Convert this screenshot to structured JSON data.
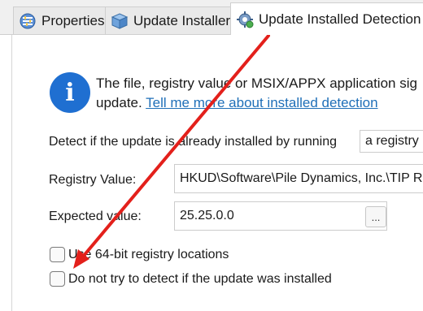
{
  "tabs": [
    {
      "label": "Properties",
      "icon": "properties-icon"
    },
    {
      "label": "Update Installer",
      "icon": "package-icon"
    },
    {
      "label": "Update Installed Detection",
      "icon": "gear-icon",
      "active": true
    }
  ],
  "info": {
    "icon": "info-icon",
    "line1": "The file, registry value or MSIX/APPX application sig",
    "line2_prefix": "update. ",
    "link": "Tell me more about installed detection"
  },
  "detection": {
    "label": "Detect if the update is already installed by running",
    "select_value": "a registry"
  },
  "registry": {
    "label": "Registry Value:",
    "value": "HKUD\\Software\\Pile Dynamics, Inc.\\TIP R"
  },
  "expected": {
    "label": "Expected value:",
    "value": "25.25.0.0",
    "browse_label": "..."
  },
  "options": {
    "use64": "Use 64-bit registry locations",
    "no_detect": "Do not try to detect if the update was installed"
  },
  "colors": {
    "accent": "#1f6fd1",
    "link": "#1f6fb8",
    "annotation_arrow": "#e3201b"
  }
}
